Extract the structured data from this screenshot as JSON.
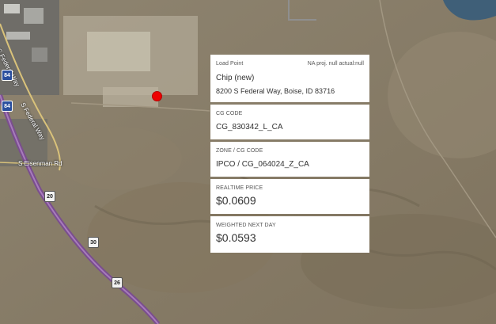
{
  "map": {
    "roads": {
      "federal_way_1": "S Federal Way",
      "federal_way_2": "S Federal Way",
      "eisenman": "S Eisenman Rd"
    },
    "shields": {
      "i84_a": "84",
      "i84_b": "84",
      "r20": "20",
      "r30": "30",
      "r26": "26"
    },
    "marker_color": "#ee0000"
  },
  "panel": {
    "load_point": {
      "label": "Load Point",
      "meta": "NA proj. null actual:null",
      "name": "Chip (new)",
      "address": "8200 S Federal Way, Boise, ID 83716"
    },
    "cg_code": {
      "label": "CG CODE",
      "value": "CG_830342_L_CA"
    },
    "zone": {
      "label": "ZONE / CG CODE",
      "value": "IPCO / CG_064024_Z_CA"
    },
    "realtime": {
      "label": "REALTIME PRICE",
      "value": "$0.0609"
    },
    "weighted": {
      "label": "WEIGHTED NEXT DAY",
      "value": "$0.0593"
    }
  }
}
